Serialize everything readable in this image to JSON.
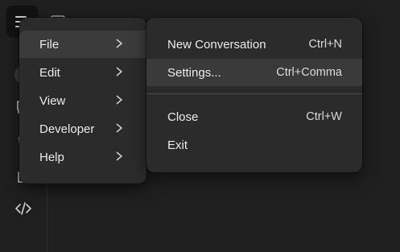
{
  "menu": {
    "main_items": [
      {
        "label": "File",
        "icon": "chevron-right-icon"
      },
      {
        "label": "Edit",
        "icon": "chevron-right-icon"
      },
      {
        "label": "View",
        "icon": "chevron-right-icon"
      },
      {
        "label": "Developer",
        "icon": "chevron-right-icon"
      },
      {
        "label": "Help",
        "icon": "chevron-right-icon"
      }
    ],
    "file_submenu": [
      {
        "label": "New Conversation",
        "shortcut": "Ctrl+N"
      },
      {
        "label": "Settings...",
        "shortcut": "Ctrl+Comma"
      },
      {
        "label": "Close",
        "shortcut": "Ctrl+W"
      },
      {
        "label": "Exit",
        "shortcut": ""
      }
    ]
  },
  "icons": {
    "app_menu": "hamburger-menu-icon",
    "rail": [
      "add-icon",
      "chat-icon",
      "trash-icon",
      "extension-icon",
      "code-icon"
    ]
  },
  "colors": {
    "background": "#1f1f1f",
    "menu_background": "#2b2b2b",
    "highlight": "#3a3a3a",
    "text": "#eaeaea"
  }
}
